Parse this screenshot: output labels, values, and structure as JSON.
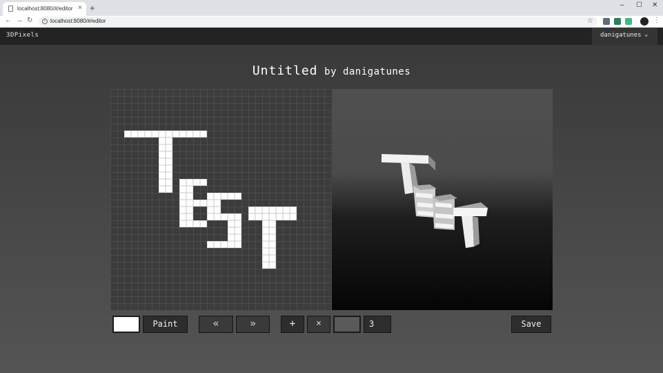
{
  "browser": {
    "tab_title": "localhost:8080/#/editor",
    "url": "localhost:8080/#/editor",
    "new_tab_icon": "+",
    "close_tab_icon": "×"
  },
  "app": {
    "brand": "3DPixels",
    "user": "danigatunes"
  },
  "editor": {
    "title": "Untitled",
    "byline": "by danigatunes",
    "grid_cols": 32,
    "grid_rows": 32,
    "pixel_color": "#ffffff",
    "pixels": [
      [
        2,
        6
      ],
      [
        3,
        6
      ],
      [
        4,
        6
      ],
      [
        5,
        6
      ],
      [
        6,
        6
      ],
      [
        7,
        6
      ],
      [
        8,
        6
      ],
      [
        9,
        6
      ],
      [
        10,
        6
      ],
      [
        11,
        6
      ],
      [
        12,
        6
      ],
      [
        13,
        6
      ],
      [
        7,
        7
      ],
      [
        8,
        7
      ],
      [
        7,
        8
      ],
      [
        8,
        8
      ],
      [
        7,
        9
      ],
      [
        8,
        9
      ],
      [
        7,
        10
      ],
      [
        8,
        10
      ],
      [
        7,
        11
      ],
      [
        8,
        11
      ],
      [
        7,
        12
      ],
      [
        8,
        12
      ],
      [
        7,
        13
      ],
      [
        8,
        13
      ],
      [
        7,
        14
      ],
      [
        8,
        14
      ],
      [
        10,
        13
      ],
      [
        11,
        13
      ],
      [
        12,
        13
      ],
      [
        13,
        13
      ],
      [
        10,
        14
      ],
      [
        11,
        14
      ],
      [
        10,
        15
      ],
      [
        11,
        15
      ],
      [
        10,
        16
      ],
      [
        11,
        16
      ],
      [
        12,
        16
      ],
      [
        13,
        16
      ],
      [
        10,
        17
      ],
      [
        11,
        17
      ],
      [
        10,
        18
      ],
      [
        11,
        18
      ],
      [
        10,
        19
      ],
      [
        11,
        19
      ],
      [
        12,
        19
      ],
      [
        13,
        19
      ],
      [
        14,
        15
      ],
      [
        15,
        15
      ],
      [
        16,
        15
      ],
      [
        17,
        15
      ],
      [
        18,
        15
      ],
      [
        14,
        16
      ],
      [
        15,
        16
      ],
      [
        14,
        17
      ],
      [
        15,
        17
      ],
      [
        14,
        18
      ],
      [
        15,
        18
      ],
      [
        16,
        18
      ],
      [
        17,
        18
      ],
      [
        18,
        18
      ],
      [
        17,
        19
      ],
      [
        18,
        19
      ],
      [
        17,
        20
      ],
      [
        18,
        20
      ],
      [
        17,
        21
      ],
      [
        18,
        21
      ],
      [
        17,
        22
      ],
      [
        18,
        22
      ],
      [
        14,
        22
      ],
      [
        15,
        22
      ],
      [
        16,
        22
      ],
      [
        20,
        17
      ],
      [
        21,
        17
      ],
      [
        22,
        17
      ],
      [
        23,
        17
      ],
      [
        24,
        17
      ],
      [
        25,
        17
      ],
      [
        26,
        17
      ],
      [
        20,
        18
      ],
      [
        21,
        18
      ],
      [
        22,
        18
      ],
      [
        23,
        18
      ],
      [
        24,
        18
      ],
      [
        25,
        18
      ],
      [
        26,
        18
      ],
      [
        22,
        19
      ],
      [
        23,
        19
      ],
      [
        22,
        20
      ],
      [
        23,
        20
      ],
      [
        22,
        21
      ],
      [
        23,
        21
      ],
      [
        22,
        22
      ],
      [
        23,
        22
      ],
      [
        22,
        23
      ],
      [
        23,
        23
      ],
      [
        22,
        24
      ],
      [
        23,
        24
      ],
      [
        22,
        25
      ],
      [
        23,
        25
      ]
    ]
  },
  "controls": {
    "current_color": "#ffffff",
    "paint_label": "Paint",
    "undo_icon": "«",
    "redo_icon": "»",
    "add_icon": "+",
    "remove_icon": "×",
    "layer_count": "3",
    "save_label": "Save"
  }
}
